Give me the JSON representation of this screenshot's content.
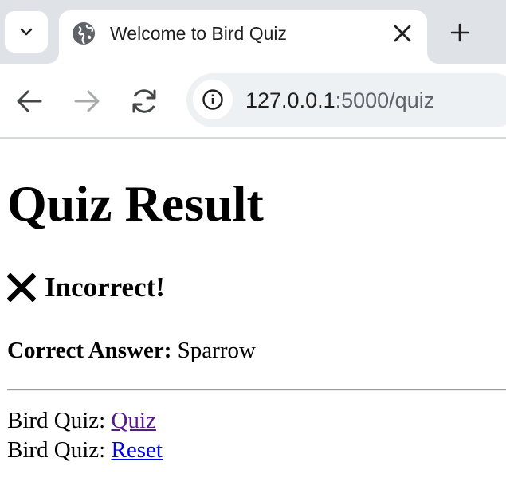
{
  "browser": {
    "tab": {
      "title": "Welcome to Bird Quiz",
      "favicon": "globe-icon"
    },
    "tab_menu_icon": "chevron-down-icon",
    "new_tab_icon": "plus-icon",
    "nav": {
      "back_icon": "arrow-left-icon",
      "forward_icon": "arrow-right-icon",
      "reload_icon": "reload-icon"
    },
    "omnibox": {
      "site_info_icon": "info-icon",
      "url_host": "127.0.0.1",
      "url_rest": ":5000/quiz"
    }
  },
  "page": {
    "title": "Quiz Result",
    "result_icon": "cross-icon",
    "result_text": "Incorrect!",
    "answer_label": "Correct Answer:",
    "answer_value": " Sparrow",
    "links": [
      {
        "prefix": "Bird Quiz: ",
        "label": "Quiz"
      },
      {
        "prefix": "Bird Quiz: ",
        "label": "Reset"
      }
    ]
  },
  "colors": {
    "visited_link": "#551a8b",
    "unvisited_link": "#0000ee",
    "tabstrip": "#dfe3e7",
    "omnibox": "#eef1f4"
  }
}
